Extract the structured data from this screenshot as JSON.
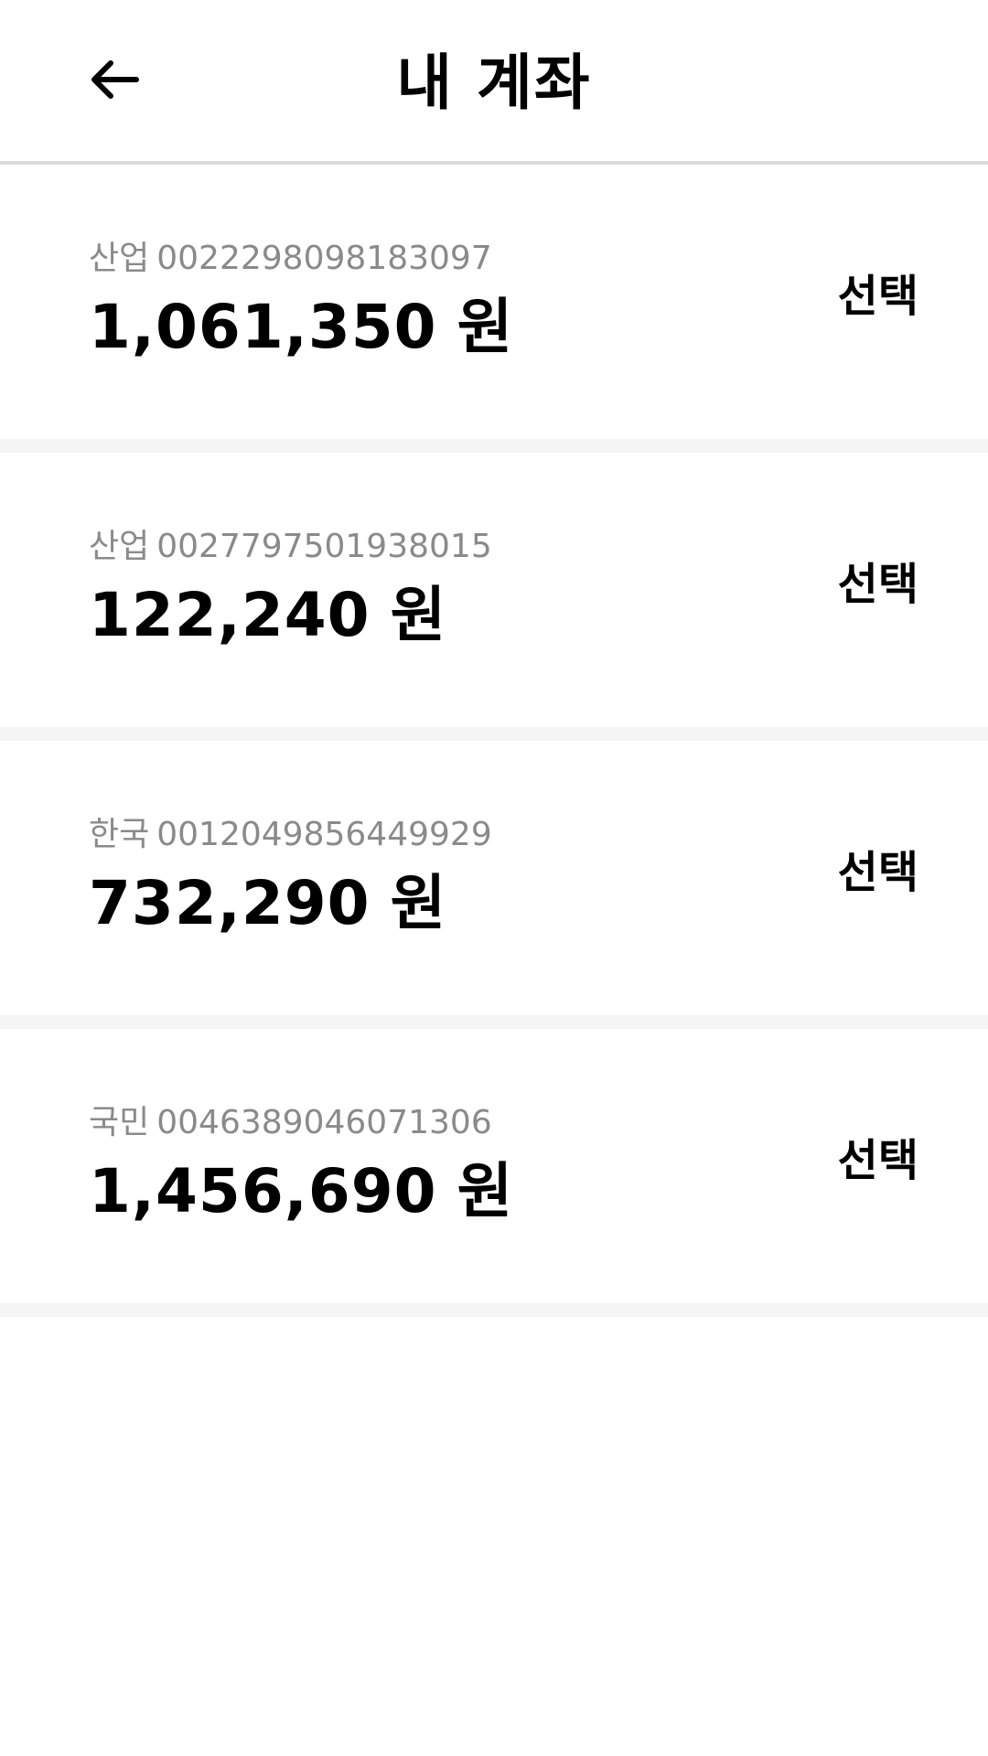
{
  "header": {
    "back_icon": "arrow-left-icon",
    "title": "내 계좌"
  },
  "accounts": [
    {
      "bank": "산업",
      "number": "0022298098183097",
      "balance": "1,061,350",
      "unit": "원",
      "select_label": "선택"
    },
    {
      "bank": "산업",
      "number": "0027797501938015",
      "balance": "122,240",
      "unit": "원",
      "select_label": "선택"
    },
    {
      "bank": "한국",
      "number": "0012049856449929",
      "balance": "732,290",
      "unit": "원",
      "select_label": "선택"
    },
    {
      "bank": "국민",
      "number": "0046389046071306",
      "balance": "1,456,690",
      "unit": "원",
      "select_label": "선택"
    }
  ],
  "colors": {
    "divider": "#dcdcdc",
    "separator": "#f5f5f5",
    "meta_text": "#8a8a8a",
    "primary_text": "#000000"
  }
}
